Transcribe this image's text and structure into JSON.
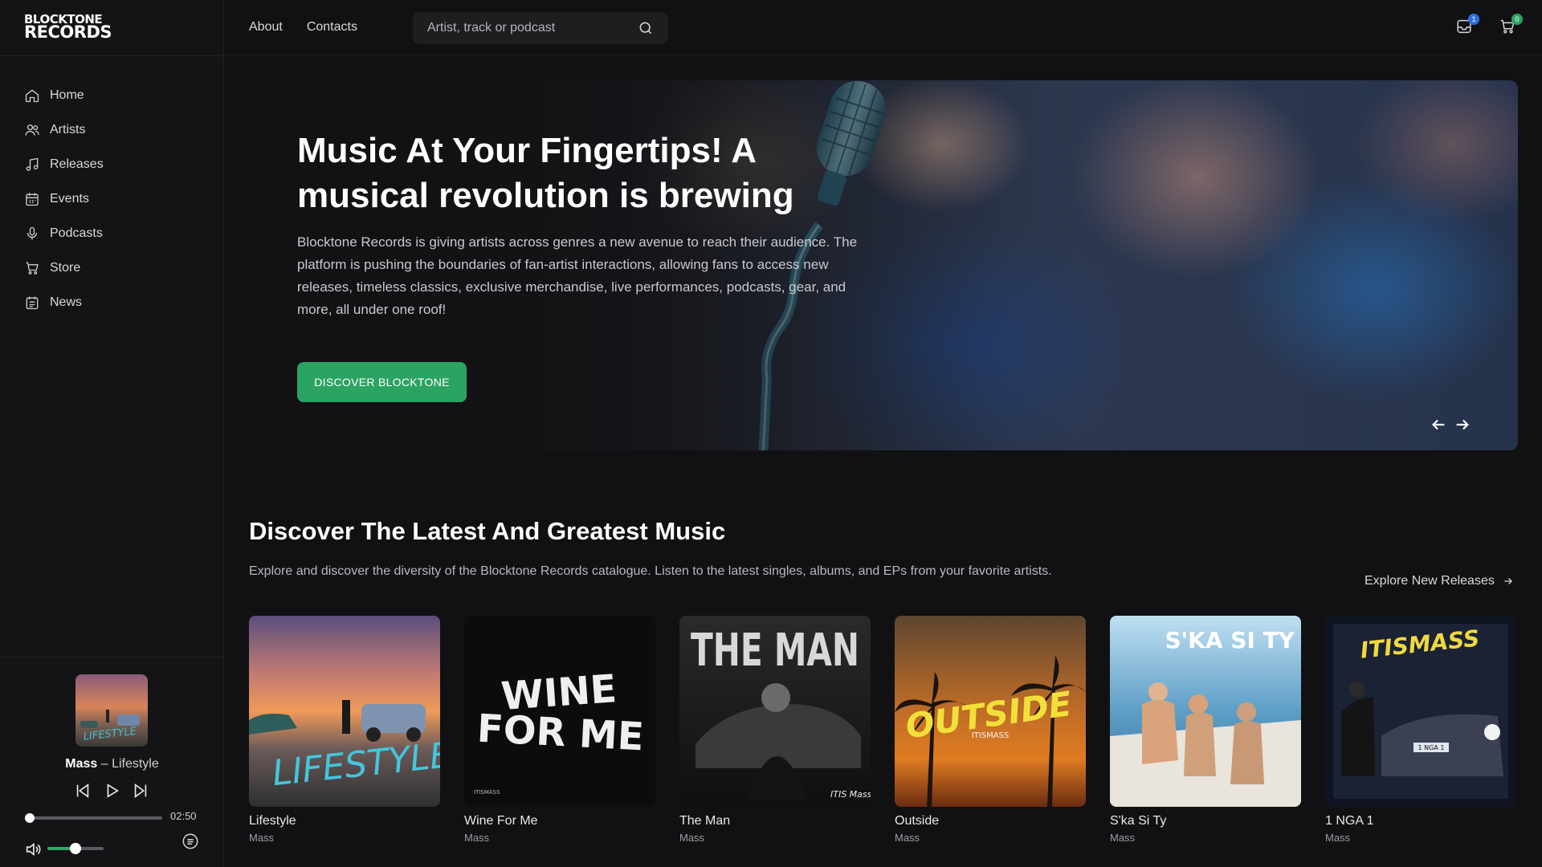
{
  "brand": {
    "line1": "BLOCKTONE",
    "line2": "RECORDS"
  },
  "sidebar": {
    "items": [
      {
        "label": "Home",
        "icon": "home-icon"
      },
      {
        "label": "Artists",
        "icon": "users-icon"
      },
      {
        "label": "Releases",
        "icon": "music-note-icon"
      },
      {
        "label": "Events",
        "icon": "calendar-icon"
      },
      {
        "label": "Podcasts",
        "icon": "microphone-icon"
      },
      {
        "label": "Store",
        "icon": "cart-icon"
      },
      {
        "label": "News",
        "icon": "newspaper-icon"
      }
    ]
  },
  "player": {
    "artist": "Mass",
    "separator": " – ",
    "track": "Lifestyle",
    "time": "02:50",
    "progress": 0.0,
    "volume": 0.5
  },
  "header": {
    "nav": [
      "About",
      "Contacts"
    ],
    "search_placeholder": "Artist, track or podcast",
    "inbox_count": "1",
    "cart_count": "0"
  },
  "hero": {
    "title": "Music At Your Fingertips! A musical revolution is brewing",
    "text": "Blocktone Records is giving artists across genres a new avenue to reach their audience. The platform is pushing the boundaries of fan-artist interactions, allowing fans to access new releases, timeless classics, exclusive merchandise, live performances, podcasts, gear, and more, all under one roof!",
    "button": "DISCOVER BLOCKTONE"
  },
  "section": {
    "title": "Discover The Latest And Greatest Music",
    "subtitle": "Explore and discover the diversity of the Blocktone Records catalogue. Listen to the latest singles, albums, and EPs from your favorite artists.",
    "link": "Explore New Releases"
  },
  "releases": [
    {
      "title": "Lifestyle",
      "artist": "Mass",
      "art_text": "LIFESTYLE"
    },
    {
      "title": "Wine For Me",
      "artist": "Mass",
      "art_text": "WINE FOR ME",
      "art_small": "ITISMASS"
    },
    {
      "title": "The Man",
      "artist": "Mass",
      "art_text": "THE MAN",
      "art_small": "ITIS Mass"
    },
    {
      "title": "Outside",
      "artist": "Mass",
      "art_text": "OUTSIDE",
      "art_small": "ITISMASS"
    },
    {
      "title": "S'ka Si Ty",
      "artist": "Mass",
      "art_text": "S'KA SI TY"
    },
    {
      "title": "1 NGA 1",
      "artist": "Mass",
      "art_text": "ITISMASS",
      "art_small": "1 NGA 1"
    }
  ],
  "colors": {
    "accent": "#2ba363",
    "background": "#111113",
    "sidebar": "#141416"
  }
}
